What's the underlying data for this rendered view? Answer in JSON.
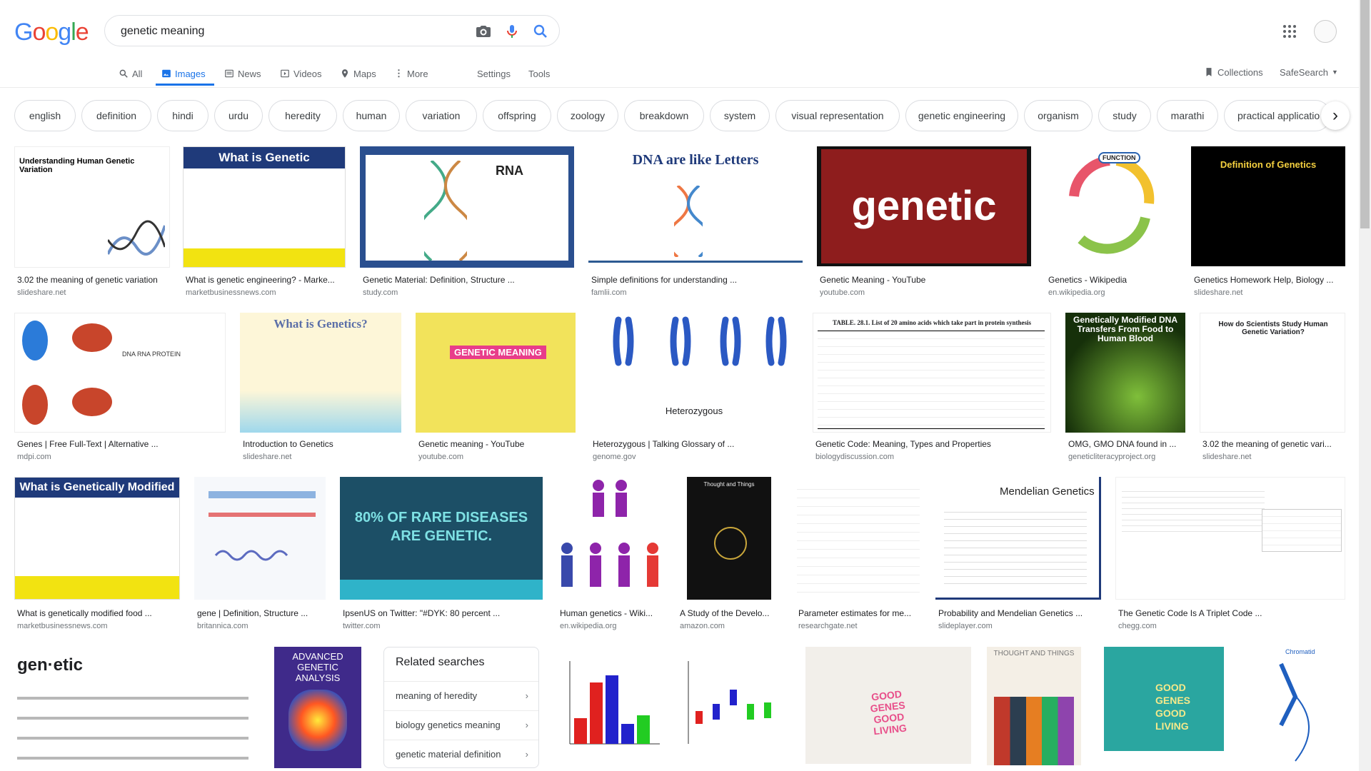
{
  "search": {
    "query": "genetic meaning"
  },
  "tabs": [
    {
      "label": "All",
      "icon": "search-icon"
    },
    {
      "label": "Images",
      "icon": "image-icon"
    },
    {
      "label": "News",
      "icon": "news-icon"
    },
    {
      "label": "Videos",
      "icon": "video-icon"
    },
    {
      "label": "Maps",
      "icon": "map-pin-icon"
    },
    {
      "label": "More",
      "icon": "more-vert-icon"
    }
  ],
  "tools": {
    "settings": "Settings",
    "tools": "Tools",
    "collections": "Collections",
    "safesearch": "SafeSearch"
  },
  "chips": [
    "english",
    "definition",
    "hindi",
    "urdu",
    "heredity",
    "human",
    "variation",
    "offspring",
    "zoology",
    "breakdown",
    "system",
    "visual representation",
    "genetic engineering",
    "organism",
    "study",
    "marathi",
    "practical applicatio"
  ],
  "results": [
    {
      "caption": "3.02 the meaning of genetic variation",
      "source": "slideshare.net",
      "thumb_text": "Understanding Human Genetic Variation"
    },
    {
      "caption": "What is genetic engineering? - Marke...",
      "source": "marketbusinessnews.com",
      "thumb_text": "What is Genetic Engineering?"
    },
    {
      "caption": "Genetic Material: Definition, Structure ...",
      "source": "study.com",
      "thumb_text": "RNA"
    },
    {
      "caption": "Simple definitions for understanding ...",
      "source": "famlii.com",
      "thumb_text": "DNA are like Letters"
    },
    {
      "caption": "Genetic Meaning - YouTube",
      "source": "youtube.com",
      "thumb_text": "genetic"
    },
    {
      "caption": "Genetics - Wikipedia",
      "source": "en.wikipedia.org",
      "thumb_text": "FUNCTION"
    },
    {
      "caption": "Genetics Homework Help, Biology ...",
      "source": "slideshare.net",
      "thumb_text": "Definition of Genetics"
    },
    {
      "caption": "Genes | Free Full-Text | Alternative ...",
      "source": "mdpi.com",
      "thumb_text": "DNA RNA PROTEIN"
    },
    {
      "caption": "Introduction to Genetics",
      "source": "slideshare.net",
      "thumb_text": "What is Genetics?"
    },
    {
      "caption": "Genetic meaning - YouTube",
      "source": "youtube.com",
      "thumb_text": "GENETIC MEANING"
    },
    {
      "caption": "Heterozygous | Talking Glossary of ...",
      "source": "genome.gov",
      "thumb_text": "Heterozygous"
    },
    {
      "caption": "Genetic Code: Meaning, Types and Properties",
      "source": "biologydiscussion.com",
      "thumb_text": "TABLE. 28.1. List of 20 amino acids which take part in protein synthesis"
    },
    {
      "caption": "OMG, GMO DNA found in ...",
      "source": "geneticliteracyproject.org",
      "thumb_text": "Genetically Modified DNA Transfers From Food to Human Blood"
    },
    {
      "caption": "3.02 the meaning of genetic vari...",
      "source": "slideshare.net",
      "thumb_text": "How do Scientists Study Human Genetic Variation?"
    },
    {
      "caption": "What is genetically modified food ...",
      "source": "marketbusinessnews.com",
      "thumb_text": "What is Genetically Modified Food?"
    },
    {
      "caption": "gene | Definition, Structure ...",
      "source": "britannica.com",
      "thumb_text": ""
    },
    {
      "caption": "IpsenUS on Twitter: \"#DYK: 80 percent ...",
      "source": "twitter.com",
      "thumb_text": "80% OF RARE DISEASES ARE GENETIC."
    },
    {
      "caption": "Human genetics - Wiki...",
      "source": "en.wikipedia.org",
      "thumb_text": ""
    },
    {
      "caption": "A Study of the Develo...",
      "source": "amazon.com",
      "thumb_text": "Thought and Things"
    },
    {
      "caption": "Parameter estimates for me...",
      "source": "researchgate.net",
      "thumb_text": ""
    },
    {
      "caption": "Probability and Mendelian Genetics ...",
      "source": "slideplayer.com",
      "thumb_text": "Mendelian Genetics"
    },
    {
      "caption": "The Genetic Code Is A Triplet Code ...",
      "source": "chegg.com",
      "thumb_text": ""
    }
  ],
  "row4": [
    {
      "thumb_text": "gen·etic"
    },
    {
      "thumb_text": "ADVANCED GENETIC ANALYSIS"
    },
    {
      "thumb_text": ""
    },
    {
      "thumb_text": "GOOD GENES GOOD LIVING"
    },
    {
      "thumb_text": "THOUGHT AND THINGS"
    },
    {
      "thumb_text": "GOOD GENES GOOD LIVING"
    },
    {
      "thumb_text": "Chromatid"
    }
  ],
  "related": {
    "title": "Related searches",
    "items": [
      "meaning of heredity",
      "biology genetics meaning",
      "genetic material definition"
    ]
  }
}
